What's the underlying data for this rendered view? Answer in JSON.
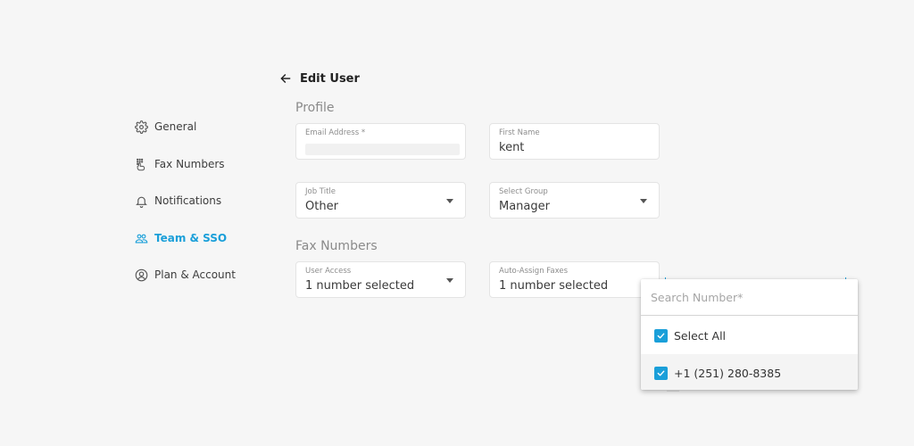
{
  "sidebar": {
    "active_color": "#1a9fd9",
    "items": [
      {
        "label": "General",
        "icon": "gear-icon",
        "active": false
      },
      {
        "label": "Fax Numbers",
        "icon": "keypad-hand-icon",
        "active": false
      },
      {
        "label": "Notifications",
        "icon": "bell-icon",
        "active": false
      },
      {
        "label": "Team & SSO",
        "icon": "users-icon",
        "active": true
      },
      {
        "label": "Plan & Account",
        "icon": "user-circle-icon",
        "active": false
      }
    ]
  },
  "header": {
    "back_icon": "arrow-left-icon",
    "title": "Edit User"
  },
  "profile": {
    "section_title": "Profile",
    "email": {
      "label": "Email Address *",
      "value": ""
    },
    "first_name": {
      "label": "First Name",
      "value": "kent"
    },
    "job_title": {
      "label": "Job Title",
      "value": "Other"
    },
    "group": {
      "label": "Select Group",
      "value": "Manager"
    }
  },
  "fax_numbers": {
    "section_title": "Fax Numbers",
    "user_access": {
      "label": "User Access",
      "value": "1 number selected"
    },
    "auto_assign": {
      "label": "Auto-Assign Faxes",
      "value": "1 number selected"
    }
  },
  "dropdown": {
    "search_placeholder": "Search Number*",
    "options": [
      {
        "label": "Select All",
        "checked": true
      },
      {
        "label": "+1 (251) 280-8385",
        "checked": true
      }
    ],
    "checkbox_color": "#1a9fd9"
  }
}
